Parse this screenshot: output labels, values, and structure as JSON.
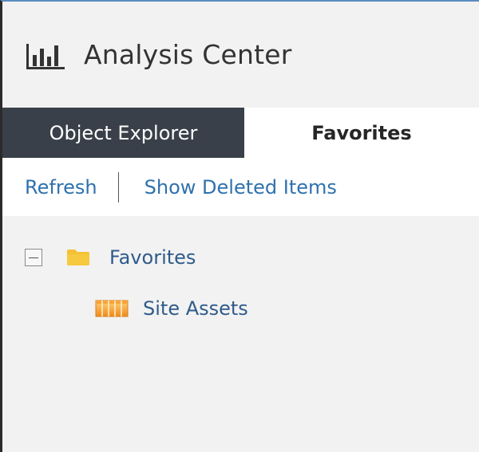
{
  "header": {
    "title": "Analysis Center",
    "icon": "bar-chart-icon"
  },
  "tabs": [
    {
      "label": "Object Explorer",
      "active": true
    },
    {
      "label": "Favorites",
      "active": false
    }
  ],
  "toolbar": {
    "refresh_label": "Refresh",
    "show_deleted_label": "Show Deleted Items"
  },
  "tree": {
    "root": {
      "label": "Favorites",
      "icon": "folder-icon",
      "expanded": true
    },
    "children": [
      {
        "label": "Site Assets",
        "icon": "grid-icon"
      }
    ]
  },
  "colors": {
    "active_tab_bg": "#394049",
    "link": "#2f71ad",
    "folder": "#f5c033",
    "grid_icon": "#f0a030",
    "top_border": "#5b8bc0"
  }
}
